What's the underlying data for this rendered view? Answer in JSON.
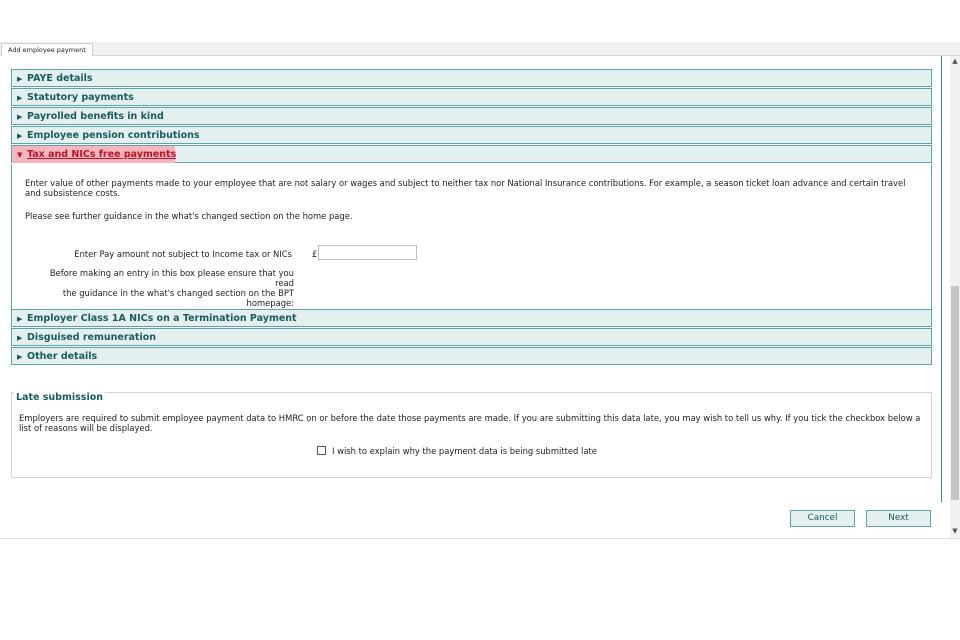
{
  "window": {
    "tab_label": "Add employee payment"
  },
  "accordion": {
    "sections": [
      {
        "label": "PAYE details"
      },
      {
        "label": "Statutory payments"
      },
      {
        "label": "Payrolled benefits in kind"
      },
      {
        "label": "Employee pension contributions"
      },
      {
        "label": "Tax and NICs free payments",
        "expanded": true
      },
      {
        "label": "Employer Class 1A NICs on a Termination Payment"
      },
      {
        "label": "Disguised remuneration"
      },
      {
        "label": "Other details"
      }
    ]
  },
  "tax_free": {
    "intro_line1": "Enter value of other payments made to your employee that are not salary or wages and subject to neither tax nor National Insurance contributions. For example, a season ticket loan advance and certain travel",
    "intro_line2": "and subsistence costs.",
    "guidance": "Please see further guidance in the what's changed section on the home page.",
    "pay_label": "Enter Pay amount not subject to Income tax or NICs",
    "currency_symbol": "£",
    "pay_value": "",
    "help_line1": "Before making an entry in this box please ensure that you read",
    "help_line2": "the guidance in the what's changed section on the BPT",
    "help_line3": "homepage:"
  },
  "late_submission": {
    "legend": "Late submission",
    "text_line1": "Employers are required to submit employee payment data to HMRC on or before the date those payments are made. If you are submitting this data late, you may wish to tell us why. If you tick the checkbox below a",
    "text_line2": "list of reasons will be displayed.",
    "checkbox_label": "I wish to explain why the payment data is being submitted late",
    "checked": false
  },
  "buttons": {
    "cancel": "Cancel",
    "next": "Next"
  },
  "colors": {
    "accent": "#1a5c5c",
    "header_bg": "#e4eff0",
    "border": "#5aa6a6",
    "active_highlight": "#f3b7bd",
    "active_text": "#c0102a"
  }
}
